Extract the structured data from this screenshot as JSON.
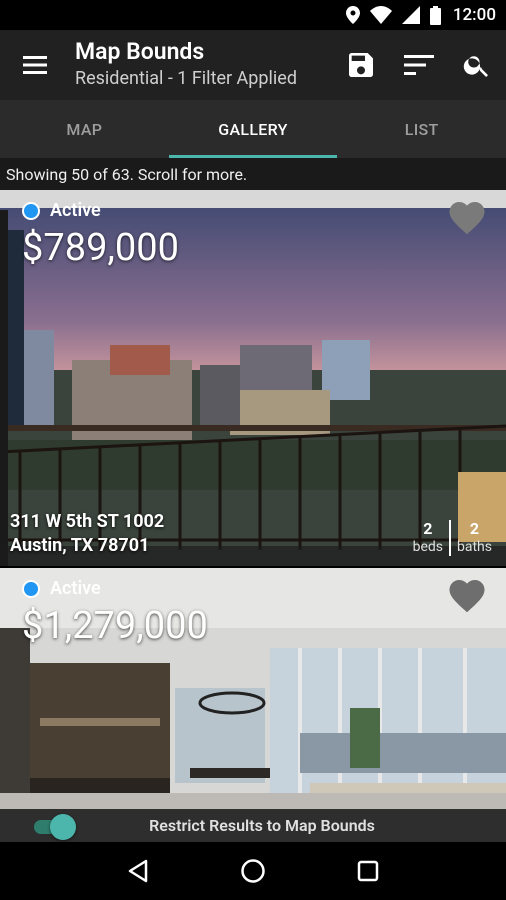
{
  "status_bar": {
    "time": "12:00"
  },
  "app_bar": {
    "title": "Map Bounds",
    "subtitle": "Residential - 1 Filter Applied",
    "icons": [
      "menu-icon",
      "save-icon",
      "sort-icon",
      "search-icon"
    ]
  },
  "tabs": [
    {
      "label": "MAP",
      "active": false
    },
    {
      "label": "GALLERY",
      "active": true
    },
    {
      "label": "LIST",
      "active": false
    }
  ],
  "results_text": "Showing 50 of 63. Scroll for more.",
  "listings": [
    {
      "status": "Active",
      "price": "$789,000",
      "address_line1": "311 W 5th ST 1002",
      "address_line2": "Austin, TX 78701",
      "beds": "2",
      "beds_label": "beds",
      "baths": "2",
      "baths_label": "baths"
    },
    {
      "status": "Active",
      "price": "$1,279,000"
    }
  ],
  "restrict_toggle": {
    "label": "Restrict Results to Map Bounds",
    "on": true
  },
  "colors": {
    "accent": "#4db6ac",
    "active_dot": "#2196f3",
    "appbar": "#212121",
    "tabs": "#2b2b2b"
  }
}
